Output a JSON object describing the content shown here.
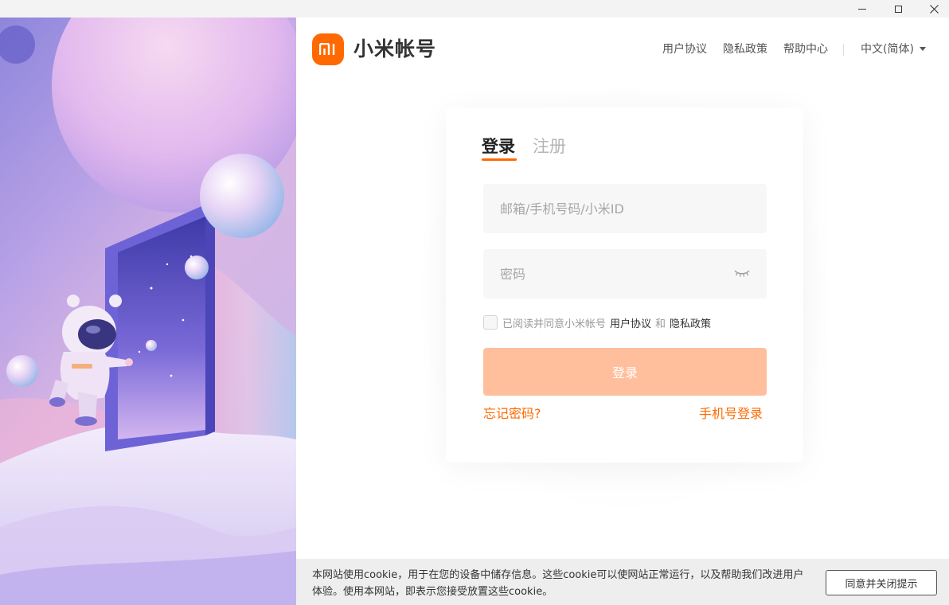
{
  "window": {
    "controls": {
      "minimize_icon": "minimize-icon",
      "maximize_icon": "maximize-icon",
      "close_icon": "close-icon"
    }
  },
  "header": {
    "logo_text": "mi",
    "brand": "小米帐号",
    "nav": [
      "用户协议",
      "隐私政策",
      "帮助中心"
    ],
    "language": "中文(简体)"
  },
  "login": {
    "tabs": {
      "active": "登录",
      "inactive": "注册"
    },
    "account_placeholder": "邮箱/手机号码/小米ID",
    "password_placeholder": "密码",
    "agreement": {
      "prefix": "已阅读并同意小米帐号",
      "terms": "用户协议",
      "and": "和",
      "privacy": "隐私政策"
    },
    "submit": "登录",
    "forgot": "忘记密码?",
    "phone_login": "手机号登录"
  },
  "cookie": {
    "text": "本网站使用cookie，用于在您的设备中储存信息。这些cookie可以使网站正常运行，以及帮助我们改进用户体验。使用本网站，即表示您接受放置这些cookie。",
    "button": "同意并关闭提示"
  },
  "colors": {
    "accent": "#ff6900",
    "button_disabled": "#ffbf9c"
  }
}
